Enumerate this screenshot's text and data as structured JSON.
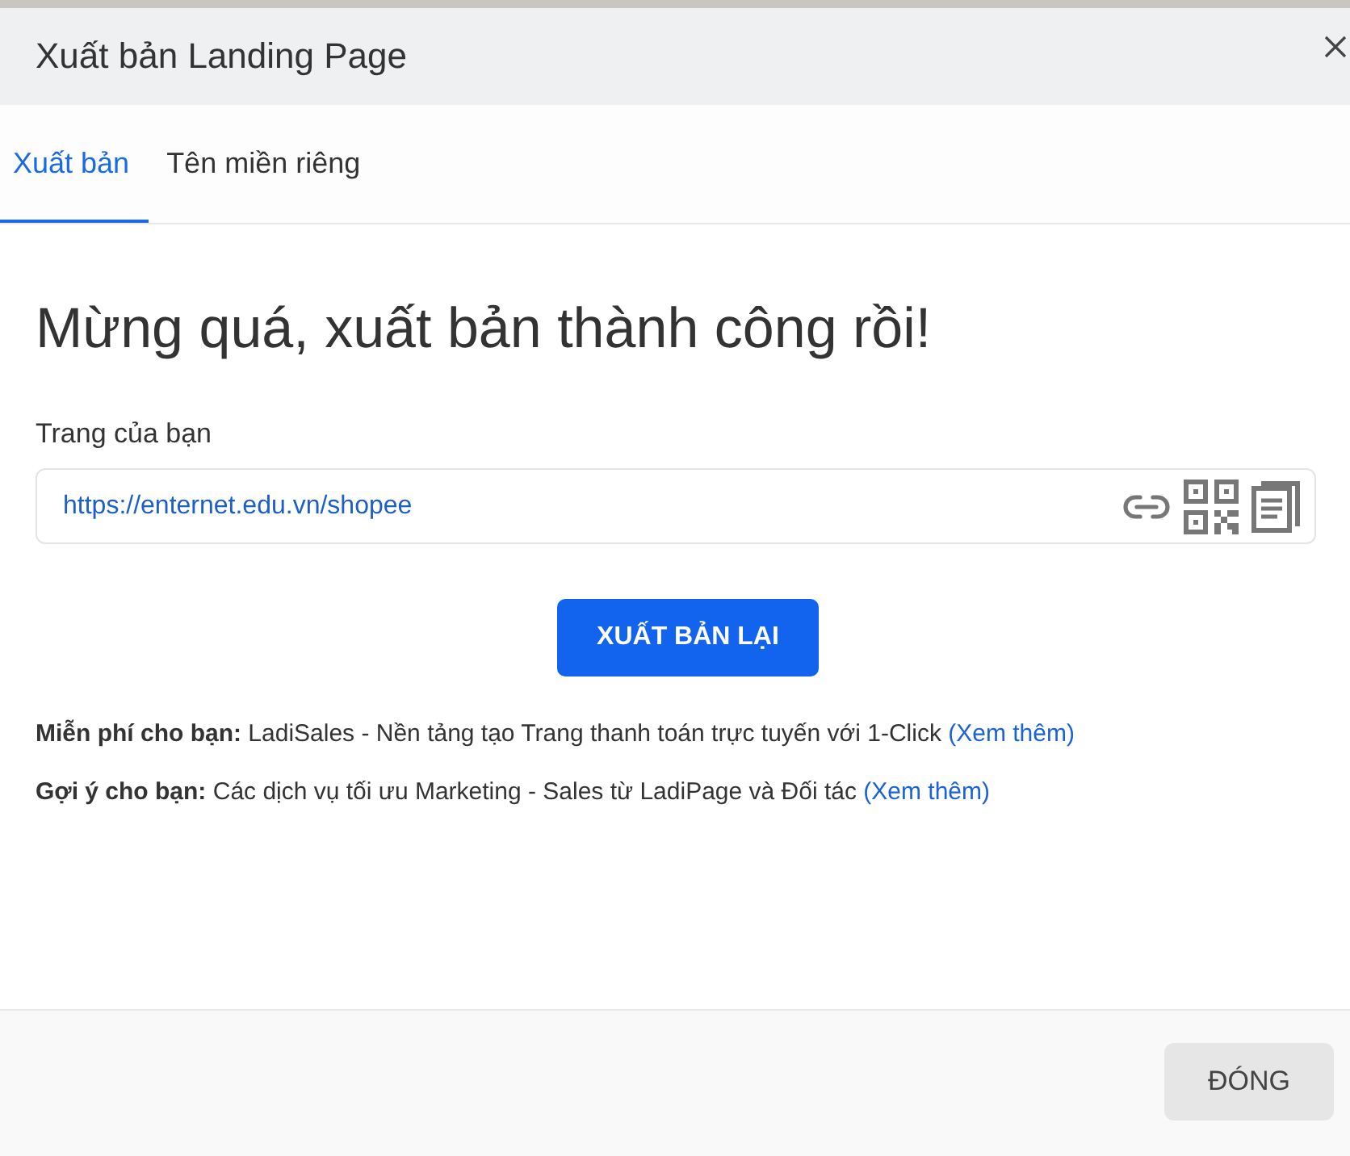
{
  "dialog": {
    "title": "Xuất bản Landing Page"
  },
  "tabs": [
    {
      "label": "Xuất bản",
      "selected": true
    },
    {
      "label": "Tên miền riêng",
      "selected": false
    }
  ],
  "heading": "Mừng quá, xuất bản thành công rồi!",
  "page_field": {
    "label": "Trang của bạn",
    "value": "https://enternet.edu.vn/shopee"
  },
  "republish_button": "XUẤT BẢN LẠI",
  "promos": [
    {
      "text": "**Miễn phí cho bạn:** LadiSales - Nền tảng tạo Trang thanh toán trực tuyến với 1-Click",
      "link": "(Xem thêm)"
    },
    {
      "text": "**Gợi ý cho bạn:** Các dịch vụ tối ưu Marketing - Sales từ LadiPage và Đối tác",
      "link": "(Xem thêm)"
    }
  ],
  "footer": {
    "close_button": "ĐÓNG"
  }
}
